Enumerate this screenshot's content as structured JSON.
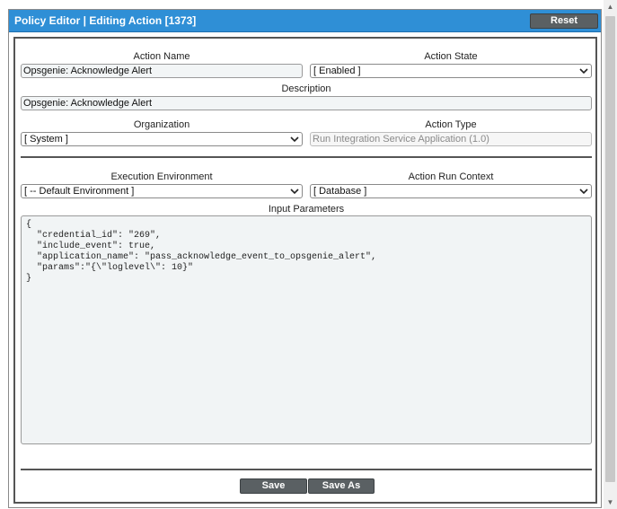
{
  "window": {
    "title": "Policy Editor | Editing Action [1373]",
    "reset_label": "Reset"
  },
  "form": {
    "action_name": {
      "label": "Action Name",
      "value": "Opsgenie: Acknowledge Alert"
    },
    "action_state": {
      "label": "Action State",
      "value": "[ Enabled ]"
    },
    "description": {
      "label": "Description",
      "value": "Opsgenie: Acknowledge Alert"
    },
    "organization": {
      "label": "Organization",
      "value": "[ System ]"
    },
    "action_type": {
      "label": "Action Type",
      "value": "Run Integration Service Application (1.0)"
    },
    "execution_environment": {
      "label": "Execution Environment",
      "value": "[ -- Default Environment ]"
    },
    "action_run_context": {
      "label": "Action Run Context",
      "value": "[ Database ]"
    },
    "input_parameters": {
      "label": "Input Parameters",
      "value": "{\n  \"credential_id\": \"269\",\n  \"include_event\": true,\n  \"application_name\": \"pass_acknowledge_event_to_opsgenie_alert\",\n  \"params\":\"{\\\"loglevel\\\": 10}\"\n}"
    }
  },
  "buttons": {
    "save": "Save",
    "save_as": "Save As"
  },
  "colors": {
    "titlebar": "#2f8fd6",
    "button": "#5a6063"
  },
  "icons": {
    "select_arrow": "chevron-down-icon"
  }
}
